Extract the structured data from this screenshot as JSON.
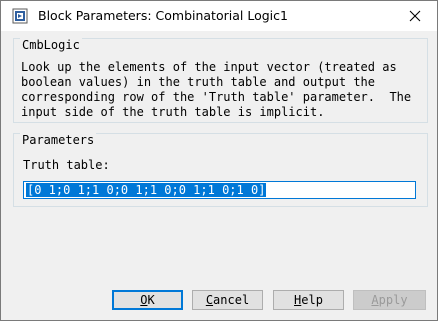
{
  "window": {
    "title": "Block Parameters: Combinatorial  Logic1",
    "close_glyph": "✕"
  },
  "block_group": {
    "title": "CmbLogic",
    "description": "Look up the elements of the input vector (treated as\nboolean values) in the truth table and output the\ncorresponding row of the 'Truth table' parameter.  The\ninput side of the truth table is implicit."
  },
  "params_group": {
    "title": "Parameters",
    "truth_table_label": "Truth table:",
    "truth_table_value": "[0 1;0 1;1 0;0 1;1 0;0 1;1 0;1 0]"
  },
  "buttons": {
    "ok_accel": "O",
    "ok_rest": "K",
    "cancel_accel": "C",
    "cancel_rest": "ancel",
    "help_accel": "H",
    "help_rest": "elp",
    "apply_accel": "A",
    "apply_rest": "pply"
  },
  "colors": {
    "accent": "#0078d7",
    "window_bg": "#f0f0f0"
  }
}
